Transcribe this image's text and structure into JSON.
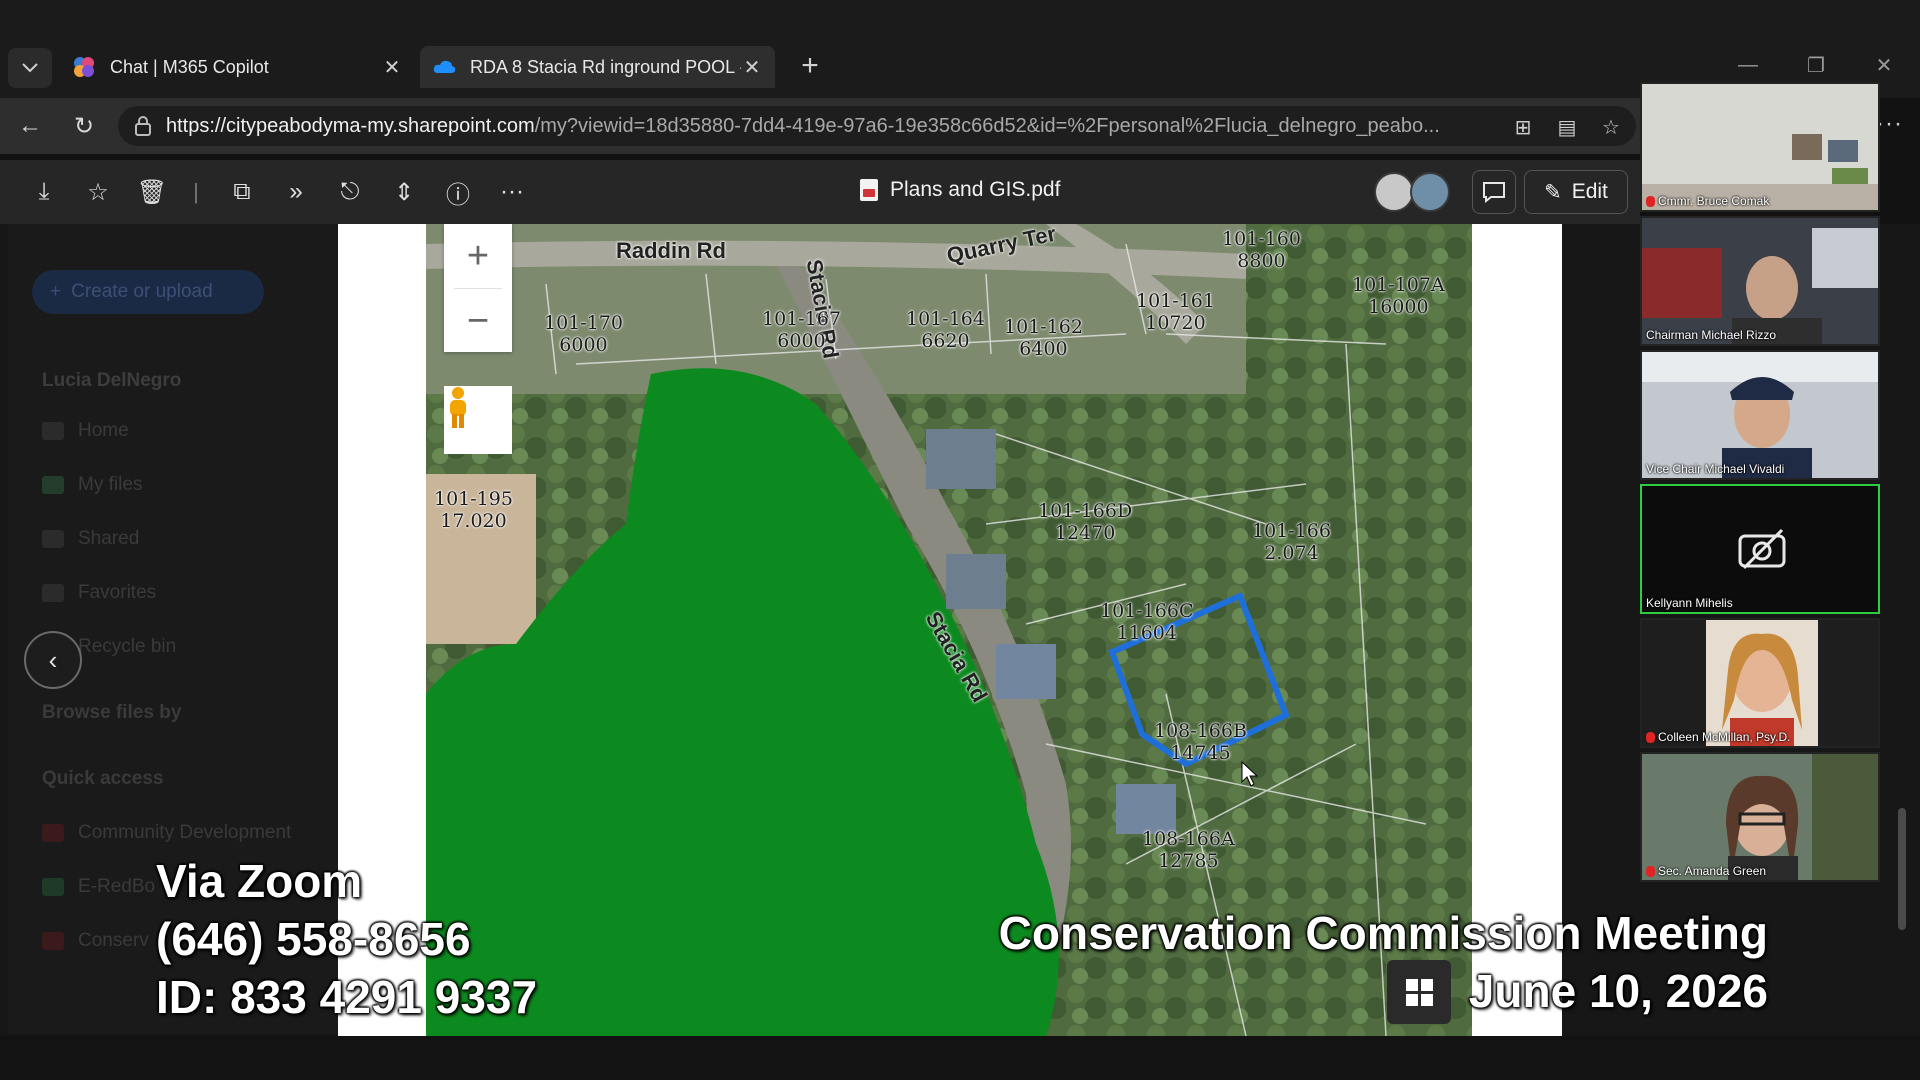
{
  "browser": {
    "tabs": [
      {
        "label": "Chat | M365 Copilot",
        "icon": "copilot-icon",
        "active": false
      },
      {
        "label": "RDA 8 Stacia Rd inground POOL - ",
        "icon": "onedrive-cloud-icon",
        "active": true
      }
    ],
    "url_host": "https://citypeabodyma-my.sharepoint.com",
    "url_path": "/my?viewid=18d35880-7dd4-419e-97a6-19e358c66d52&id=%2Fpersonal%2Flucia_delnegro_peabo..."
  },
  "viewer": {
    "document_title": "Plans and GIS.pdf",
    "edit_label": "Edit"
  },
  "sidebar": {
    "create_label": "Create or upload",
    "user": "Lucia DelNegro",
    "items": [
      "Home",
      "My files",
      "Shared",
      "Favorites",
      "Recycle bin"
    ],
    "browse_heading": "Browse files by",
    "quick_access_heading": "Quick access",
    "quick_access": [
      "Community Development",
      "E-RedBo",
      "Conserv"
    ]
  },
  "map": {
    "roads": [
      "Raddin Rd",
      "Quarry Ter",
      "Stacia Rd",
      "Stacia Rd"
    ],
    "parcels": [
      {
        "id": "101-170",
        "area": "6000"
      },
      {
        "id": "101-167",
        "area": "6000"
      },
      {
        "id": "101-164",
        "area": "6620"
      },
      {
        "id": "101-162",
        "area": "6400"
      },
      {
        "id": "101-161",
        "area": "10720"
      },
      {
        "id": "101-160",
        "area": "8800"
      },
      {
        "id": "101-107A",
        "area": "16000"
      },
      {
        "id": "101-195",
        "area": "17.020"
      },
      {
        "id": "101-166D",
        "area": "12470"
      },
      {
        "id": "101-166",
        "area": "2.074"
      },
      {
        "id": "101-166C",
        "area": "11604"
      },
      {
        "id": "108-166B",
        "area": "14745"
      },
      {
        "id": "108-166A",
        "area": "12785"
      }
    ],
    "highlight_color": "#1e6fd9",
    "wetland_color": "#0d8a1f"
  },
  "participants": [
    {
      "name": "Cmmr. Bruce Comak",
      "muted": true
    },
    {
      "name": "Chairman Michael Rizzo",
      "muted": false
    },
    {
      "name": "Vice Chair Michael Vivaldi",
      "muted": false
    },
    {
      "name": "Kellyann Mihelis",
      "muted": false,
      "video_off": true,
      "active_speaker": true
    },
    {
      "name": "Colleen McMillan, Psy.D.",
      "muted": true
    },
    {
      "name": "Sec. Amanda Green",
      "muted": true
    }
  ],
  "overlay": {
    "zoom_line": "Via Zoom",
    "phone": "(646) 558-8656",
    "meeting_id": "ID:  833 4291 9337",
    "meeting_title": "Conservation Commission Meeting",
    "meeting_date": "June 10, 2026"
  }
}
